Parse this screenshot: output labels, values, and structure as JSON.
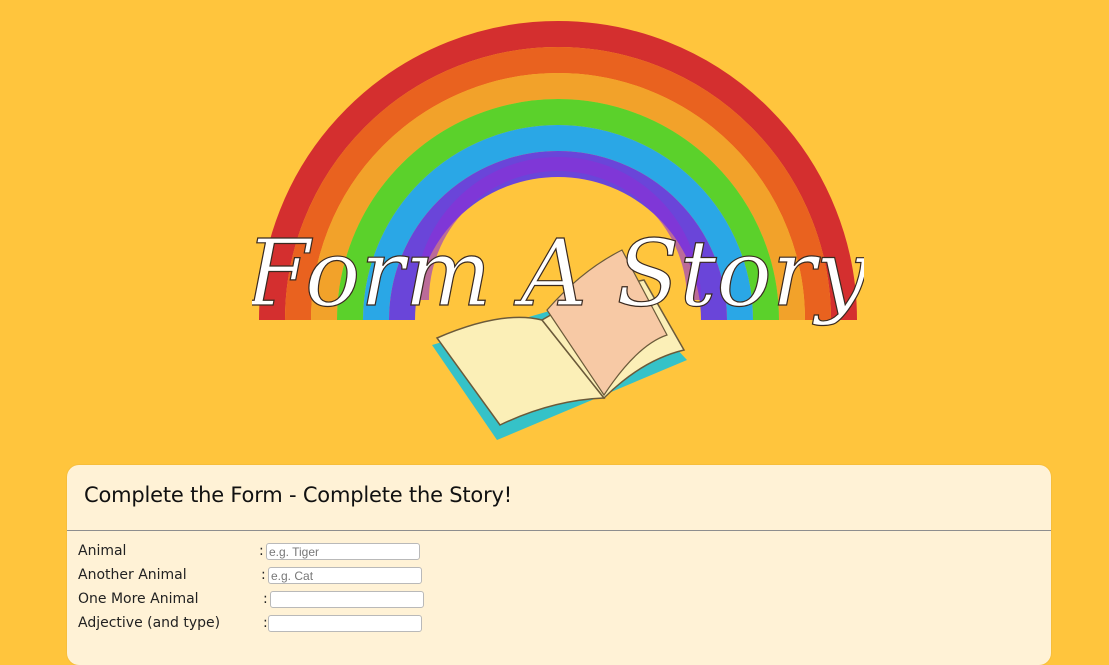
{
  "hero": {
    "logo_text": "Form A Story",
    "colors": {
      "background": "#ffc53d",
      "rainbow": [
        "#d42f2f",
        "#e9621f",
        "#f2a22a",
        "#5bd12b",
        "#2aa7e6",
        "#6a45d9",
        "#8d2fd6"
      ],
      "book_pages": "#fbefb7",
      "book_cover": "#35c2c8"
    }
  },
  "form": {
    "title": "Complete the Form - Complete the Story!",
    "fields": [
      {
        "label": "Animal",
        "colon": ":",
        "placeholder": "e.g. Tiger",
        "value": ""
      },
      {
        "label": "Another Animal",
        "colon": ":",
        "placeholder": "e.g. Cat",
        "value": ""
      },
      {
        "label": "One More Animal",
        "colon": ":",
        "placeholder": "",
        "value": ""
      },
      {
        "label": "Adjective (and type)",
        "colon": ":",
        "placeholder": "",
        "value": ""
      }
    ]
  }
}
